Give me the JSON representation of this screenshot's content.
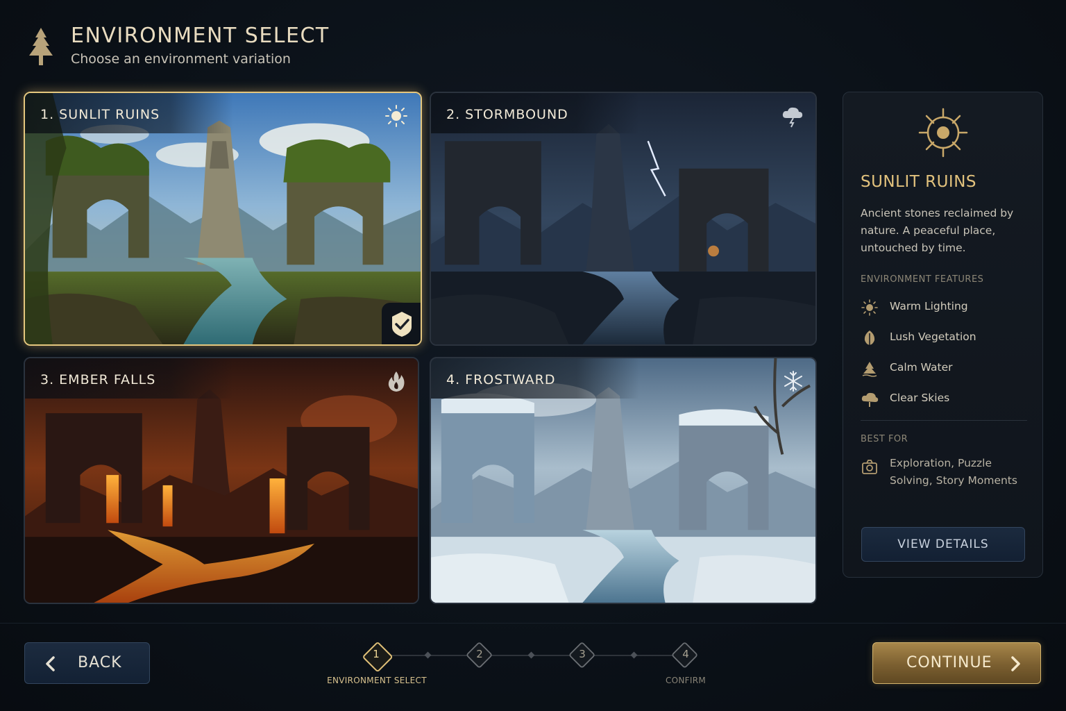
{
  "header": {
    "title": "ENVIRONMENT SELECT",
    "subtitle": "Choose an environment variation",
    "icon": "pine-tree-icon"
  },
  "environments": [
    {
      "label": "1. SUNLIT RUINS",
      "icon": "sun-icon",
      "selected": true
    },
    {
      "label": "2. STORMBOUND",
      "icon": "storm-cloud-icon",
      "selected": false
    },
    {
      "label": "3. EMBER FALLS",
      "icon": "flame-icon",
      "selected": false
    },
    {
      "label": "4. FROSTWARD",
      "icon": "snowflake-icon",
      "selected": false
    }
  ],
  "panel": {
    "title": "SUNLIT RUINS",
    "description": "Ancient stones reclaimed by nature. A peaceful place, untouched by time.",
    "features_heading": "ENVIRONMENT FEATURES",
    "features": [
      {
        "label": "Warm Lighting",
        "icon": "sun-icon"
      },
      {
        "label": "Lush Vegetation",
        "icon": "leaf-icon"
      },
      {
        "label": "Calm Water",
        "icon": "water-icon"
      },
      {
        "label": "Clear Skies",
        "icon": "cloud-icon"
      }
    ],
    "best_for_heading": "BEST FOR",
    "best_for": "Exploration, Puzzle Solving, Story Moments",
    "view_details_label": "VIEW DETAILS"
  },
  "footer": {
    "back_label": "BACK",
    "continue_label": "CONTINUE",
    "steps": [
      {
        "number": "1",
        "label": "ENVIRONMENT SELECT",
        "active": true
      },
      {
        "number": "2",
        "label": "",
        "active": false
      },
      {
        "number": "3",
        "label": "",
        "active": false
      },
      {
        "number": "4",
        "label": "CONFIRM",
        "active": false
      }
    ]
  },
  "colors": {
    "accent_gold": "#e2c27d",
    "background": "#0b1118",
    "button_blue": "#1b2a3e"
  }
}
